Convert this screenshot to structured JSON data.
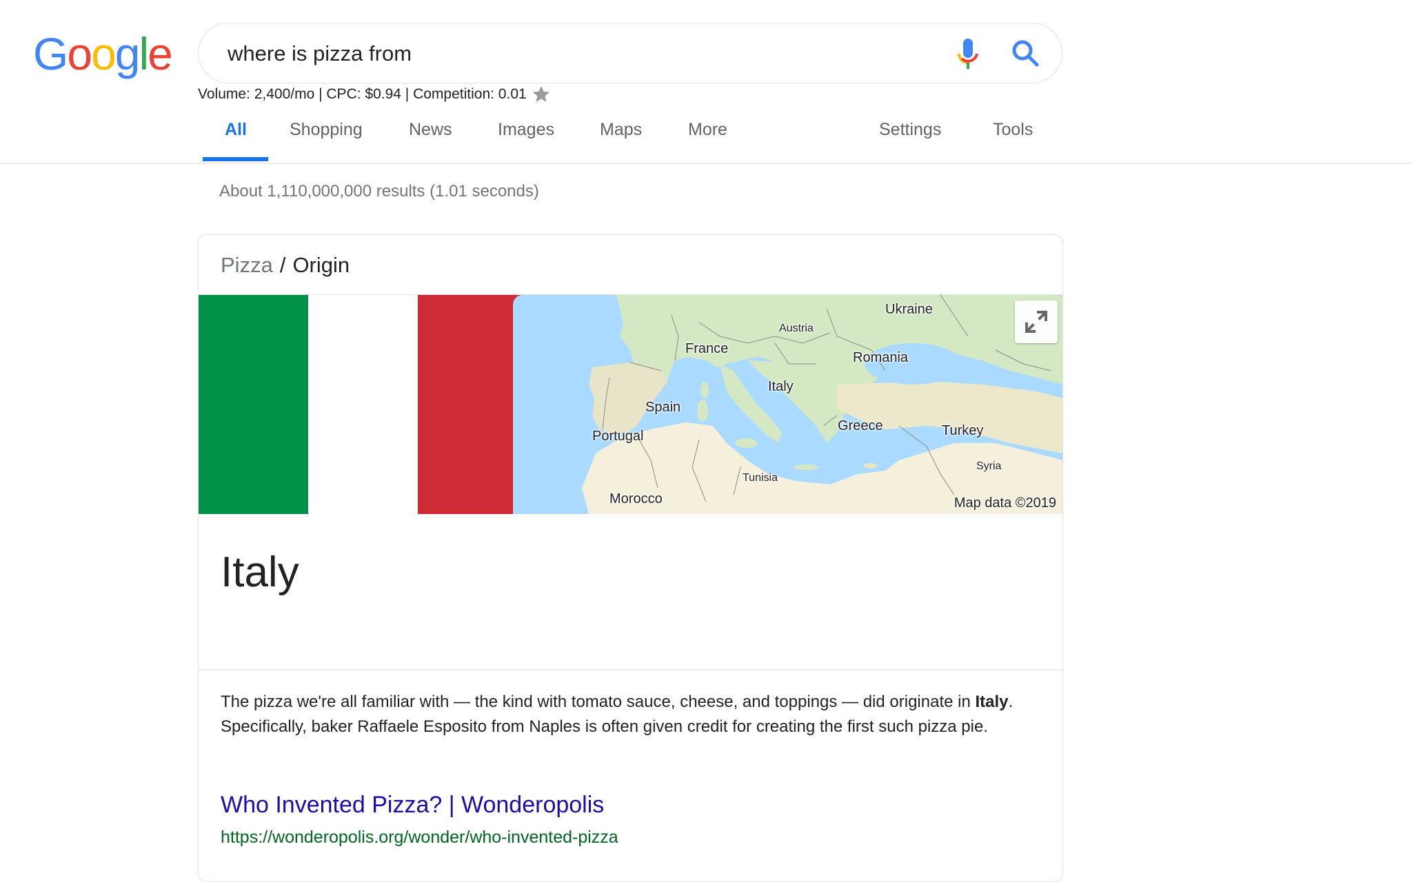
{
  "logo": {
    "letters": [
      {
        "ch": "G",
        "color": "#4285F4"
      },
      {
        "ch": "o",
        "color": "#EA4335"
      },
      {
        "ch": "o",
        "color": "#FBBC05"
      },
      {
        "ch": "g",
        "color": "#4285F4"
      },
      {
        "ch": "l",
        "color": "#34A853"
      },
      {
        "ch": "e",
        "color": "#EA4335"
      }
    ]
  },
  "search": {
    "query": "where is pizza from",
    "mic_icon": "microphone-icon",
    "search_icon": "magnifier-icon"
  },
  "keyword_stats": {
    "text": "Volume: 2,400/mo | CPC: $0.94 | Competition: 0.01",
    "star_icon": "star-icon"
  },
  "tabs": {
    "items": [
      {
        "label": "All",
        "active": true
      },
      {
        "label": "Shopping"
      },
      {
        "label": "News"
      },
      {
        "label": "Images"
      },
      {
        "label": "Maps"
      },
      {
        "label": "More"
      }
    ],
    "settings": "Settings",
    "tools": "Tools",
    "accent": "#1a73e8"
  },
  "stats": "About 1,110,000,000 results (1.01 seconds)",
  "card": {
    "breadcrumb": {
      "parent": "Pizza",
      "separator": "/",
      "current": "Origin"
    },
    "flag_colors": {
      "green": "#009246",
      "white": "#ffffff",
      "red": "#ce2b37"
    },
    "map": {
      "labels": [
        "Ukraine",
        "Austria",
        "France",
        "Romania",
        "Italy",
        "Spain",
        "Greece",
        "Portugal",
        "Turkey",
        "Syria",
        "Tunisia",
        "Morocco"
      ],
      "attribution": "Map data ©2019",
      "expand_icon": "expand-icon"
    },
    "answer": "Italy",
    "description": {
      "before": "The pizza we're all familiar with — the kind with tomato sauce, cheese, and toppings — did originate in ",
      "bold": "Italy",
      "after": ". Specifically, baker Raffaele Esposito from Naples is often given credit for creating the first such pizza pie."
    },
    "source": {
      "title": "Who Invented Pizza? | Wonderopolis",
      "url": "https://wonderopolis.org/wonder/who-invented-pizza"
    }
  }
}
